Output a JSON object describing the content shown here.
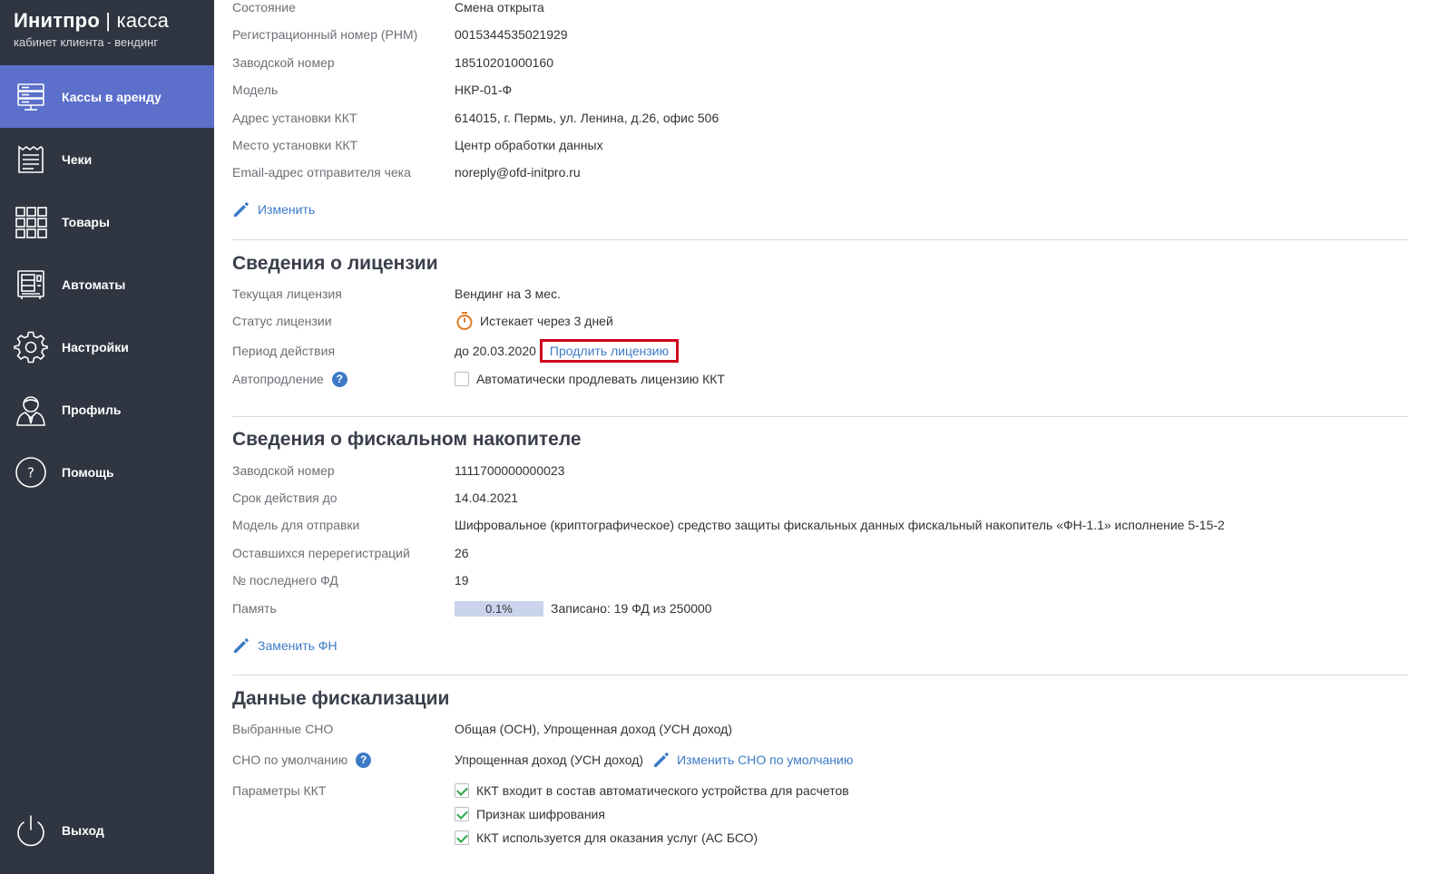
{
  "brand": {
    "name": "Инитпро",
    "separator": "|",
    "product": "касса",
    "subtitle": "кабинет клиента - вендинг"
  },
  "nav": {
    "items": [
      {
        "label": "Кассы в аренду",
        "icon": "server-icon",
        "active": true
      },
      {
        "label": "Чеки",
        "icon": "receipt-icon"
      },
      {
        "label": "Товары",
        "icon": "grid-icon"
      },
      {
        "label": "Автоматы",
        "icon": "vending-machine-icon"
      },
      {
        "label": "Настройки",
        "icon": "gear-icon"
      },
      {
        "label": "Профиль",
        "icon": "user-icon"
      },
      {
        "label": "Помощь",
        "icon": "help-icon"
      }
    ],
    "logout": {
      "label": "Выход",
      "icon": "power-icon"
    }
  },
  "kkt": {
    "rows": [
      {
        "label": "Состояние",
        "value": "Смена открыта"
      },
      {
        "label": "Регистрационный номер (РНМ)",
        "value": "0015344535021929"
      },
      {
        "label": "Заводской номер",
        "value": "18510201000160"
      },
      {
        "label": "Модель",
        "value": "НКР-01-Ф"
      },
      {
        "label": "Адрес установки ККТ",
        "value": "614015, г. Пермь, ул. Ленина, д.26, офис 506"
      },
      {
        "label": "Место установки ККТ",
        "value": "Центр обработки данных"
      },
      {
        "label": "Email-адрес отправителя чека",
        "value": "noreply@ofd-initpro.ru"
      }
    ],
    "edit_label": "Изменить"
  },
  "license": {
    "title": "Сведения о лицензии",
    "current_label": "Текущая лицензия",
    "current_value": "Вендинг на 3 мес.",
    "status_label": "Статус лицензии",
    "status_value": "Истекает через 3 дней",
    "period_label": "Период действия",
    "period_value": "до 20.03.2020",
    "extend_link": "Продлить лицензию",
    "auto_label": "Автопродление",
    "help": "?",
    "auto_checkbox_label": "Автоматически продлевать лицензию ККТ",
    "auto_checked": false
  },
  "fn": {
    "title": "Сведения о фискальном накопителе",
    "rows": [
      {
        "label": "Заводской номер",
        "value": "1111700000000023"
      },
      {
        "label": "Срок действия до",
        "value": "14.04.2021"
      },
      {
        "label": "Модель для отправки",
        "value": "Шифровальное (криптографическое) средство защиты фискальных данных фискальный накопитель «ФН-1.1» исполнение 5-15-2"
      },
      {
        "label": "Оставшихся перерегистраций",
        "value": "26"
      },
      {
        "label": "№ последнего ФД",
        "value": "19"
      }
    ],
    "memory_label": "Память",
    "memory_percent": "0.1%",
    "memory_fraction": 0.001,
    "memory_text": "Записано: 19 ФД из 250000",
    "replace_label": "Заменить ФН"
  },
  "fiscal": {
    "title": "Данные фискализации",
    "sno_label": "Выбранные СНО",
    "sno_value": "Общая (ОСН), Упрощенная доход (УСН доход)",
    "default_sno_label": "СНО по умолчанию",
    "help": "?",
    "default_sno_value": "Упрощенная доход (УСН доход)",
    "change_sno_link": "Изменить СНО по умолчанию",
    "params_label": "Параметры ККТ",
    "params": [
      {
        "label": "ККТ входит в состав автоматического устройства для расчетов",
        "checked": true
      },
      {
        "label": "Признак шифрования",
        "checked": true
      },
      {
        "label": "ККТ используется для оказания услуг (АС БСО)",
        "checked": true
      }
    ]
  },
  "colors": {
    "sidebar": "#2f3541",
    "active": "#5b6fcb",
    "link": "#3d7ac6",
    "highlight": "#d0021b",
    "timer": "#e07b1f",
    "check": "#2aa54a"
  }
}
